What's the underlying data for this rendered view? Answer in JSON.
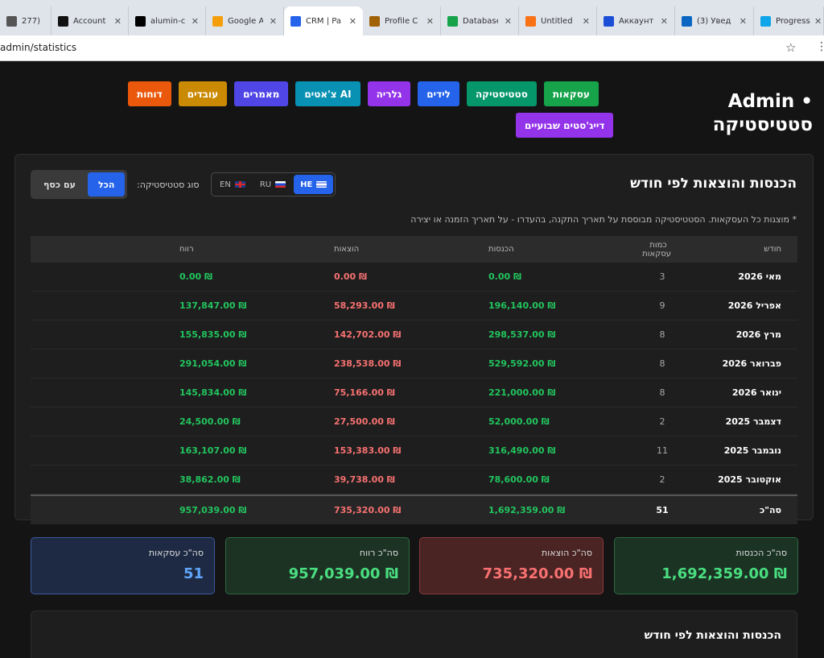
{
  "browser": {
    "tabs": [
      {
        "title": "277)",
        "icon": "speaker-icon",
        "color": "#555555",
        "active": false
      },
      {
        "title": "Account",
        "icon": "account-icon",
        "color": "#111111",
        "active": false
      },
      {
        "title": "alumin-c",
        "icon": "triangle-icon",
        "color": "#000000",
        "active": false
      },
      {
        "title": "Google A",
        "icon": "analytics-icon",
        "color": "#f59e0b",
        "active": false
      },
      {
        "title": "CRM | Pa",
        "icon": "crm-icon",
        "color": "#2563eb",
        "active": true
      },
      {
        "title": "Profile C",
        "icon": "profile-icon",
        "color": "#a16207",
        "active": false
      },
      {
        "title": "Database",
        "icon": "database-icon",
        "color": "#16a34a",
        "active": false
      },
      {
        "title": "Untitled",
        "icon": "figma-icon",
        "color": "#f97316",
        "active": false
      },
      {
        "title": "Аккаунт",
        "icon": "ads-icon",
        "color": "#1d4ed8",
        "active": false
      },
      {
        "title": "(3) Увед",
        "icon": "linkedin-icon",
        "color": "#0a66c2",
        "active": false
      },
      {
        "title": "Progress",
        "icon": "progress-icon",
        "color": "#0ea5e9",
        "active": false
      }
    ],
    "url": "admin/statistics"
  },
  "header": {
    "title_line1": "Admin •",
    "title_line2": "סטטיסטיקה"
  },
  "nav": [
    {
      "label": "עסקאות",
      "color": "#16a34a"
    },
    {
      "label": "סטטיסטיקה",
      "color": "#059669"
    },
    {
      "label": "לידים",
      "color": "#2563eb"
    },
    {
      "label": "גלריה",
      "color": "#9333ea"
    },
    {
      "label": "צ'אטים AI",
      "color": "#0891b2"
    },
    {
      "label": "מאמרים",
      "color": "#4f46e5"
    },
    {
      "label": "עובדים",
      "color": "#ca8a04"
    },
    {
      "label": "דוחות",
      "color": "#ea580c"
    },
    {
      "label": "דייג'סטים שבועיים",
      "color": "#9333ea"
    }
  ],
  "card": {
    "title": "הכנסות והוצאות לפי חודש",
    "languages": [
      {
        "code": "HE",
        "flag": "il",
        "active": true
      },
      {
        "code": "RU",
        "flag": "ru",
        "active": false
      },
      {
        "code": "EN",
        "flag": "gb",
        "active": false
      }
    ],
    "stat_type_label": "סוג סטטיסטיקה:",
    "stat_options": [
      {
        "label": "עם כסף",
        "active": false
      },
      {
        "label": "הכל",
        "active": true
      }
    ],
    "note": "* מוצגות כל העסקאות. הסטטיסטיקה מבוססת על תאריך התקנה, בהעדרו - על תאריך הזמנה או יצירה"
  },
  "table": {
    "headers": {
      "month": "חודש",
      "count": "כמות עסקאות",
      "income": "הכנסות",
      "expenses": "הוצאות",
      "profit": "רווח"
    },
    "rows": [
      {
        "month": "מאי 2026",
        "count": "3",
        "income": "₪ 0.00",
        "expenses": "₪ 0.00",
        "profit": "₪ 0.00"
      },
      {
        "month": "אפריל 2026",
        "count": "9",
        "income": "₪ 196,140.00",
        "expenses": "₪ 58,293.00",
        "profit": "₪ 137,847.00"
      },
      {
        "month": "מרץ 2026",
        "count": "8",
        "income": "₪ 298,537.00",
        "expenses": "₪ 142,702.00",
        "profit": "₪ 155,835.00"
      },
      {
        "month": "פברואר 2026",
        "count": "8",
        "income": "₪ 529,592.00",
        "expenses": "₪ 238,538.00",
        "profit": "₪ 291,054.00"
      },
      {
        "month": "ינואר 2026",
        "count": "8",
        "income": "₪ 221,000.00",
        "expenses": "₪ 75,166.00",
        "profit": "₪ 145,834.00"
      },
      {
        "month": "דצמבר 2025",
        "count": "2",
        "income": "₪ 52,000.00",
        "expenses": "₪ 27,500.00",
        "profit": "₪ 24,500.00"
      },
      {
        "month": "נובמבר 2025",
        "count": "11",
        "income": "₪ 316,490.00",
        "expenses": "₪ 153,383.00",
        "profit": "₪ 163,107.00"
      },
      {
        "month": "אוקטובר 2025",
        "count": "2",
        "income": "₪ 78,600.00",
        "expenses": "₪ 39,738.00",
        "profit": "₪ 38,862.00"
      }
    ],
    "total": {
      "month": "סה\"כ",
      "count": "51",
      "income": "₪ 1,692,359.00",
      "expenses": "₪ 735,320.00",
      "profit": "₪ 957,039.00"
    }
  },
  "summary": {
    "income": {
      "label": "סה\"כ הכנסות",
      "value": "₪ 1,692,359.00"
    },
    "expenses": {
      "label": "סה\"כ הוצאות",
      "value": "₪ 735,320.00"
    },
    "profit": {
      "label": "סה\"כ רווח",
      "value": "₪ 957,039.00"
    },
    "deals": {
      "label": "סה\"כ עסקאות",
      "value": "51"
    }
  },
  "chart_card": {
    "title": "הכנסות והוצאות לפי חודש"
  }
}
